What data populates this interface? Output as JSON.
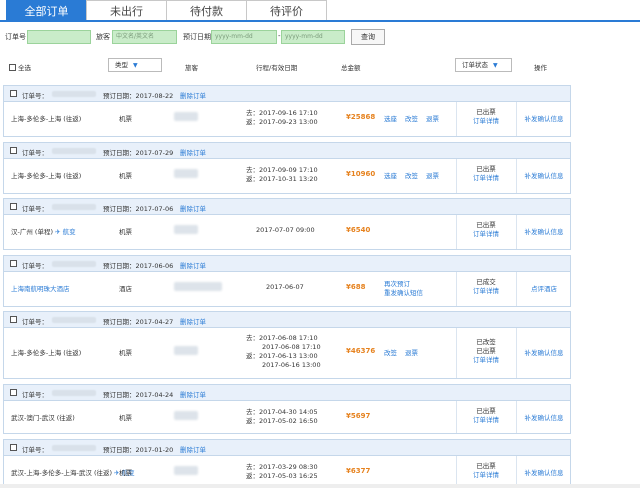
{
  "tabs": [
    "全部订单",
    "未出行",
    "待付款",
    "待评价"
  ],
  "filter": {
    "order_no_label": "订单号",
    "traveler_label": "旅客",
    "traveler_placeholder": "中文名/英文名",
    "date_label": "预订日期",
    "date_from_placeholder": "yyyy-mm-dd",
    "date_sep": "-",
    "date_to_placeholder": "yyyy-mm-dd",
    "query_label": "查询"
  },
  "header": {
    "select_all": "全选",
    "type": "类型",
    "traveler": "旅客",
    "itinerary": "行程/有效日期",
    "total": "总金额",
    "status": "订单状态",
    "operation": "操作"
  },
  "colors": {
    "accent": "#2a7bd5",
    "price": "#e6821e",
    "input_bg": "#c9ecc9"
  },
  "icons": [
    "checkbox-icon",
    "caret-down-icon",
    "plane-icon"
  ],
  "orders": [
    {
      "order_label": "订单号：",
      "book_date": "预订日期：2017-08-22",
      "delete": "删除订单",
      "route": "上海-多伦多-上海 (往返)",
      "type": "机票",
      "date_lines": [
        "去：2017-09-16 17:10",
        "返：2017-09-23 13:00"
      ],
      "price": "¥25868",
      "actions": [
        "选座",
        "改签",
        "退票"
      ],
      "status": [
        "已出票"
      ],
      "status_link": "订单详情",
      "op": "补发确认信息"
    },
    {
      "order_label": "订单号：",
      "book_date": "预订日期：2017-07-29",
      "delete": "删除订单",
      "route": "上海-多伦多-上海 (往返)",
      "type": "机票",
      "date_lines": [
        "去：2017-09-09 17:10",
        "返：2017-10-31 13:20"
      ],
      "price": "¥10960",
      "actions": [
        "选座",
        "改签",
        "退票"
      ],
      "status": [
        "已出票"
      ],
      "status_link": "订单详情",
      "op": "补发确认信息"
    },
    {
      "order_label": "订单号：",
      "book_date": "预订日期：2017-07-06",
      "delete": "删除订单",
      "route": "汉-广州 (单程)",
      "flight": "航变",
      "type": "机票",
      "date_lines": [
        "2017-07-07 09:00"
      ],
      "price": "¥6540",
      "actions": [],
      "status": [
        "已出票"
      ],
      "status_link": "订单详情",
      "op": "补发确认信息"
    },
    {
      "order_label": "订单号：",
      "book_date": "预订日期：2017-06-06",
      "delete": "删除订单",
      "route": "上海南航明珠大酒店",
      "type": "酒店",
      "date_lines": [
        "2017-06-07"
      ],
      "price": "¥688",
      "actions": [
        "再次预订",
        "重发确认短信"
      ],
      "status": [
        "已成交"
      ],
      "status_link": "订单详情",
      "op": "点评酒店"
    },
    {
      "order_label": "订单号：",
      "book_date": "预订日期：2017-04-27",
      "delete": "删除订单",
      "route": "上海-多伦多-上海 (往返)",
      "type": "机票",
      "date_lines": [
        "去：2017-06-08 17:10",
        "2017-06-08 17:10",
        "返：2017-06-13 13:00",
        "2017-06-16 13:00"
      ],
      "price": "¥46376",
      "actions": [
        "改签",
        "退票"
      ],
      "status": [
        "已改签",
        "已出票"
      ],
      "status_link": "订单详情",
      "op": "补发确认信息"
    },
    {
      "order_label": "订单号：",
      "book_date": "预订日期：2017-04-24",
      "delete": "删除订单",
      "route": "武汉-澳门-武汉 (往返)",
      "type": "机票",
      "date_lines": [
        "去：2017-04-30 14:05",
        "返：2017-05-02 16:50"
      ],
      "price": "¥5697",
      "actions": [],
      "status": [
        "已出票"
      ],
      "status_link": "订单详情",
      "op": "补发确认信息"
    },
    {
      "order_label": "订单号：",
      "book_date": "预订日期：2017-01-20",
      "delete": "删除订单",
      "route": "武汉-上海-多伦多-上海-武汉 (往返)",
      "flight": "航变",
      "type": "机票",
      "date_lines": [
        "去：2017-03-29 08:30",
        "返：2017-05-03 16:25"
      ],
      "price": "¥6377",
      "actions": [],
      "status": [
        "已出票"
      ],
      "status_link": "订单详情",
      "op": "补发确认信息"
    }
  ]
}
